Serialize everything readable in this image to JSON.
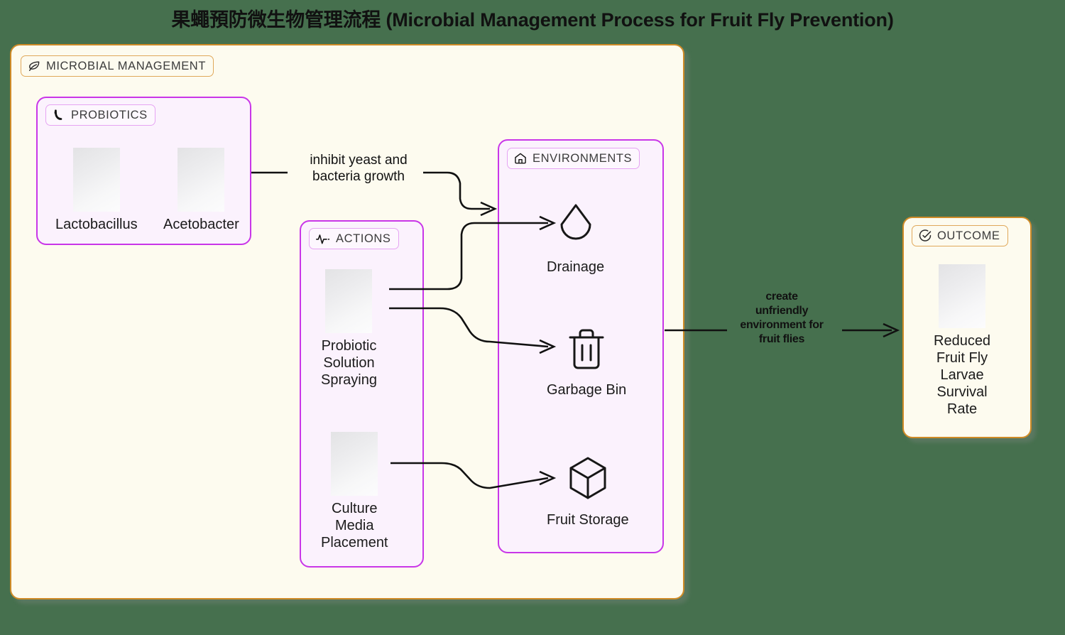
{
  "title": "果蠅預防微生物管理流程 (Microbial Management Process for Fruit Fly Prevention)",
  "colors": {
    "page_background": "#46704e",
    "cluster_cream": "#fdfbef",
    "outcome_border": "#cf8b27",
    "subcluster_background": "#fbf2fd",
    "subcluster_border": "#c936e8",
    "edge_stroke": "#111111",
    "text": "#1b1b1b"
  },
  "clusters": {
    "microbial_management": {
      "label": "MICROBIAL MANAGEMENT",
      "icon": "leaf-icon"
    },
    "probiotics": {
      "label": "PROBIOTICS",
      "icon": "bacteria-icon"
    },
    "actions": {
      "label": "ACTIONS",
      "icon": "activity-pulse-icon"
    },
    "environments": {
      "label": "ENVIRONMENTS",
      "icon": "home-icon"
    },
    "outcome": {
      "label": "OUTCOME",
      "icon": "check-circle-icon"
    }
  },
  "nodes": {
    "lactobacillus": {
      "label": "Lactobacillus",
      "kind": "image"
    },
    "acetobacter": {
      "label": "Acetobacter",
      "kind": "image"
    },
    "probiotic_solution_spraying": {
      "label": "Probiotic\nSolution\nSpraying",
      "kind": "image"
    },
    "culture_media_placement": {
      "label": "Culture\nMedia\nPlacement",
      "kind": "image"
    },
    "drainage": {
      "label": "Drainage",
      "icon": "water-droplet-icon"
    },
    "garbage_bin": {
      "label": "Garbage Bin",
      "icon": "trash-bin-icon"
    },
    "fruit_storage": {
      "label": "Fruit Storage",
      "icon": "cube-box-icon"
    },
    "reduced_survival": {
      "label": "Reduced\nFruit Fly\nLarvae\nSurvival\nRate",
      "kind": "image"
    }
  },
  "edges": [
    {
      "id": "inhibit",
      "label": "inhibit yeast and\nbacteria growth",
      "from": "probiotics",
      "to": "environments"
    },
    {
      "id": "spray_to_drainage",
      "label": "",
      "from": "probiotic_solution_spraying",
      "to": "drainage"
    },
    {
      "id": "spray_to_bin",
      "label": "",
      "from": "probiotic_solution_spraying",
      "to": "garbage_bin"
    },
    {
      "id": "media_to_storage",
      "label": "",
      "from": "culture_media_placement",
      "to": "fruit_storage"
    },
    {
      "id": "create",
      "label": "create\nunfriendly\nenvironment for\nfruit flies",
      "from": "environments",
      "to": "reduced_survival"
    }
  ]
}
